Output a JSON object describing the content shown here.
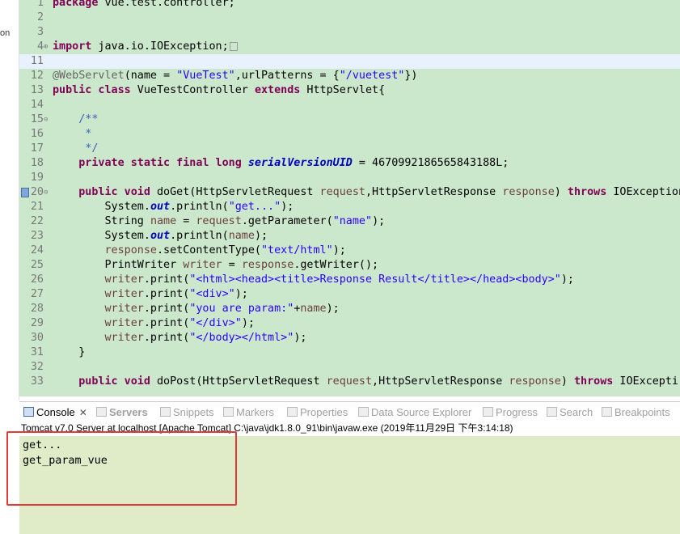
{
  "left_panel": {
    "clipped_text": "on"
  },
  "editor": {
    "lines": [
      {
        "num": "1",
        "html": "<span class=\"kw\">package</span> vue.test.controller;"
      },
      {
        "num": "2",
        "html": ""
      },
      {
        "num": "3",
        "html": ""
      },
      {
        "num": "4",
        "fold": "⊕",
        "html": "<span class=\"kw\">import</span> java.io.IOException;<span class=\"collapsed-box\"></span>"
      },
      {
        "num": "11",
        "html": "",
        "current": true
      },
      {
        "num": "12",
        "html": "<span class=\"ann\">@WebServlet</span>(name = <span class=\"str\">\"VueTest\"</span>,urlPatterns = {<span class=\"str\">\"/vuetest\"</span>})"
      },
      {
        "num": "13",
        "html": "<span class=\"kw\">public class</span> VueTestController <span class=\"kw\">extends</span> HttpServlet{"
      },
      {
        "num": "14",
        "html": ""
      },
      {
        "num": "15",
        "fold": "⊖",
        "html": "    <span class=\"cmt\">/**</span>"
      },
      {
        "num": "16",
        "html": "    <span class=\"cmt\"> *</span>"
      },
      {
        "num": "17",
        "html": "    <span class=\"cmt\"> */</span>"
      },
      {
        "num": "18",
        "html": "    <span class=\"kw\">private static final long</span> <span class=\"sfld\">serialVersionUID</span> = 4670992186565843188L;"
      },
      {
        "num": "19",
        "html": ""
      },
      {
        "num": "20",
        "fold": "⊖",
        "override": true,
        "html": "    <span class=\"kw\">public void</span> doGet(HttpServletRequest <span class=\"par\">request</span>,HttpServletResponse <span class=\"par\">response</span>) <span class=\"kw\">throws</span> IOException"
      },
      {
        "num": "21",
        "html": "        System.<span class=\"fld\">out</span>.println(<span class=\"str\">\"get...\"</span>);"
      },
      {
        "num": "22",
        "html": "        String <span class=\"lv\">name</span> = <span class=\"par\">request</span>.getParameter(<span class=\"str\">\"name\"</span>);"
      },
      {
        "num": "23",
        "html": "        System.<span class=\"fld\">out</span>.println(<span class=\"lv\">name</span>);"
      },
      {
        "num": "24",
        "html": "        <span class=\"par\">response</span>.setContentType(<span class=\"str\">\"text/html\"</span>);"
      },
      {
        "num": "25",
        "html": "        PrintWriter <span class=\"lv\">writer</span> = <span class=\"par\">response</span>.getWriter();"
      },
      {
        "num": "26",
        "html": "        <span class=\"lv\">writer</span>.print(<span class=\"str\">\"&lt;html&gt;&lt;head&gt;&lt;title&gt;Response Result&lt;/title&gt;&lt;/head&gt;&lt;body&gt;\"</span>);"
      },
      {
        "num": "27",
        "html": "        <span class=\"lv\">writer</span>.print(<span class=\"str\">\"&lt;div&gt;\"</span>);"
      },
      {
        "num": "28",
        "html": "        <span class=\"lv\">writer</span>.print(<span class=\"str\">\"you are param:\"</span>+<span class=\"lv\">name</span>);"
      },
      {
        "num": "29",
        "html": "        <span class=\"lv\">writer</span>.print(<span class=\"str\">\"&lt;/div&gt;\"</span>);"
      },
      {
        "num": "30",
        "html": "        <span class=\"lv\">writer</span>.print(<span class=\"str\">\"&lt;/body&gt;&lt;/html&gt;\"</span>);"
      },
      {
        "num": "31",
        "html": "    }"
      },
      {
        "num": "32",
        "html": ""
      },
      {
        "num": "33",
        "html": "    <span class=\"kw\">public void</span> doPost(HttpServletRequest <span class=\"par\">request</span>,HttpServletResponse <span class=\"par\">response</span>) <span class=\"kw\">throws</span> IOExcepti"
      }
    ]
  },
  "views_tabs": [
    {
      "id": "console",
      "label": "Console",
      "active": true,
      "close": "✕"
    },
    {
      "id": "servers",
      "label": "Servers"
    },
    {
      "id": "snippets",
      "label": "Snippets"
    },
    {
      "id": "markers",
      "label": "Markers"
    },
    {
      "id": "properties",
      "label": "Properties"
    },
    {
      "id": "datasource",
      "label": "Data Source Explorer"
    },
    {
      "id": "progress",
      "label": "Progress"
    },
    {
      "id": "search",
      "label": "Search"
    },
    {
      "id": "breakpoints",
      "label": "Breakpoints"
    }
  ],
  "console": {
    "header": "Tomcat v7.0 Server at localhost [Apache Tomcat] C:\\java\\jdk1.8.0_91\\bin\\javaw.exe (2019年11月29日 下午3:14:18)",
    "output": [
      "get...",
      "get_param_vue"
    ]
  },
  "colors": {
    "editor_bg": "#cce8cc",
    "console_bg": "#e0ecc8",
    "highlight_border": "#e53935",
    "keyword": "#7f0055",
    "string": "#2a00ff"
  }
}
